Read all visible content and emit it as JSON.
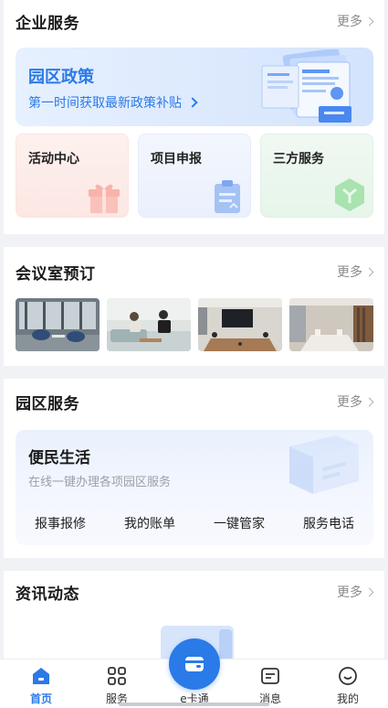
{
  "enterprise": {
    "title": "企业服务",
    "more": "更多",
    "policy": {
      "title": "园区政策",
      "subtitle": "第一时间获取最新政策补贴"
    },
    "tiles": [
      {
        "label": "活动中心",
        "icon": "gift-icon",
        "color": "#f7a9a0"
      },
      {
        "label": "项目申报",
        "icon": "clipboard-icon",
        "color": "#8fb3f2"
      },
      {
        "label": "三方服务",
        "icon": "hexagon-icon",
        "color": "#9edba6"
      }
    ]
  },
  "meeting": {
    "title": "会议室预订",
    "more": "更多",
    "rooms": [
      "room-photo-1",
      "room-photo-2",
      "room-photo-3",
      "room-photo-4"
    ]
  },
  "park": {
    "title": "园区服务",
    "more": "更多",
    "life": {
      "title": "便民生活",
      "subtitle": "在线一键办理各项园区服务",
      "actions": [
        "报事报修",
        "我的账单",
        "一键管家",
        "服务电话"
      ]
    }
  },
  "news": {
    "title": "资讯动态",
    "more": "更多"
  },
  "tabbar": {
    "tabs": [
      "首页",
      "服务",
      "e卡通",
      "消息",
      "我的"
    ],
    "active": "首页"
  },
  "colors": {
    "accent": "#2a7ae7",
    "background": "#f1f2f5"
  }
}
